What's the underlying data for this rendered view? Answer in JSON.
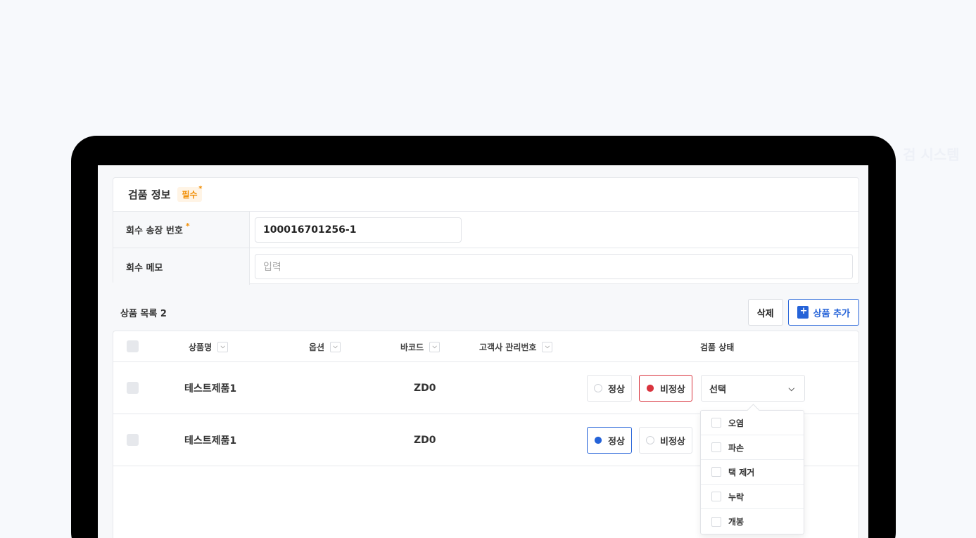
{
  "background_text": "검 시스템",
  "inspection": {
    "title": "검품 정보",
    "required_badge": "필수",
    "invoice_label": "회수 송장 번호",
    "invoice_value": "100016701256-1",
    "memo_label": "회수 메모",
    "memo_placeholder": "입력"
  },
  "product_list": {
    "title": "상품 목록 2",
    "delete_label": "삭제",
    "add_label": "상품 추가",
    "columns": {
      "name": "상품명",
      "option": "옵션",
      "barcode": "바코드",
      "client_no": "고객사 관리번호",
      "status": "검품 상태"
    },
    "rows": [
      {
        "name": "테스트제품1",
        "barcode": "ZD0",
        "normal": "정상",
        "abnormal": "비정상",
        "selected": "abnormal",
        "select_value": "선택"
      },
      {
        "name": "테스트제품1",
        "barcode": "ZD0",
        "normal": "정상",
        "abnormal": "비정상",
        "selected": "normal"
      }
    ],
    "dropdown_options": [
      "오염",
      "파손",
      "택 제거",
      "누락",
      "개봉"
    ]
  },
  "colors": {
    "accent": "#2563d8",
    "danger": "#d9343e",
    "required": "#f08c00"
  }
}
